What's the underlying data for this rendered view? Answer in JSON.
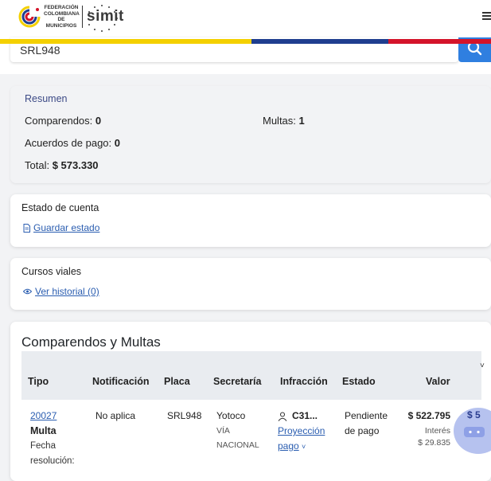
{
  "header": {
    "federation_text": [
      "FEDERACIÓN",
      "COLOMBIANA",
      "DE MUNICIPIOS"
    ],
    "brand": "simit",
    "flag_colors": [
      "#f4d000",
      "#1f3e8f",
      "#d4142a"
    ]
  },
  "search": {
    "value": "SRL948"
  },
  "resumen": {
    "title": "Resumen",
    "comparendos_label": "Comparendos:",
    "comparendos_value": "0",
    "multas_label": "Multas:",
    "multas_value": "1",
    "acuerdos_label": "Acuerdos de pago:",
    "acuerdos_value": "0",
    "total_label": "Total:",
    "total_value": "$ 573.330"
  },
  "estado_cuenta": {
    "title": "Estado de cuenta",
    "link": "Guardar estado"
  },
  "cursos": {
    "title": "Cursos viales",
    "link": "Ver historial (0)"
  },
  "comparendos": {
    "title": "Comparendos y Multas",
    "columns": [
      "Tipo",
      "Notificación",
      "Placa",
      "Secretaría",
      "Infracción",
      "Estado",
      "Valor"
    ],
    "row": {
      "numero": "20027",
      "tipo": "Multa",
      "fecha_label_1": "Fecha",
      "fecha_label_2": "resolución:",
      "notificacion": "No aplica",
      "placa": "SRL948",
      "secretaria": "Yotoco",
      "via_1": "VÍA",
      "via_2": "NACIONAL",
      "infraccion": "C31...",
      "proyeccion_1": "Proyección",
      "proyeccion_2": "pago",
      "estado_1": "Pendiente",
      "estado_2": "de pago",
      "valor": "$ 522.795",
      "interes_label": "Interés",
      "interes_value": "$ 29.835",
      "total_partial": "$ 5"
    }
  }
}
